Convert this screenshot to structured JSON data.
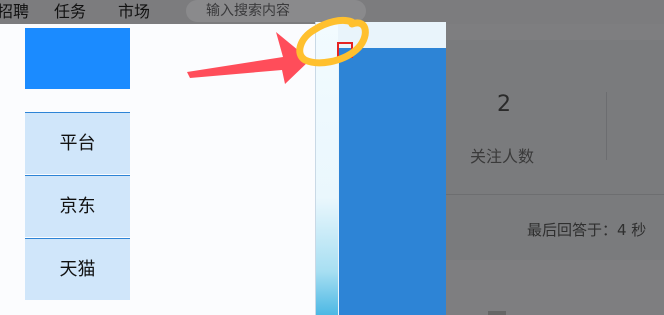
{
  "topbar": {
    "nav": [
      "招聘",
      "任务",
      "市场"
    ],
    "search_placeholder": "输入搜索内容"
  },
  "background_stats": {
    "number": "2",
    "label": "关注人数",
    "last_answer": "最后回答于：4 秒"
  },
  "popup": {
    "buttons": [
      "平台",
      "京东",
      "天猫"
    ],
    "header_color": "#1b8bff",
    "button_color": "#d0e6fa"
  },
  "annotations": {
    "arrow_color": "#ff4d5a",
    "circle_color": "#ffc02e",
    "highlight_box_color": "#e52222"
  }
}
